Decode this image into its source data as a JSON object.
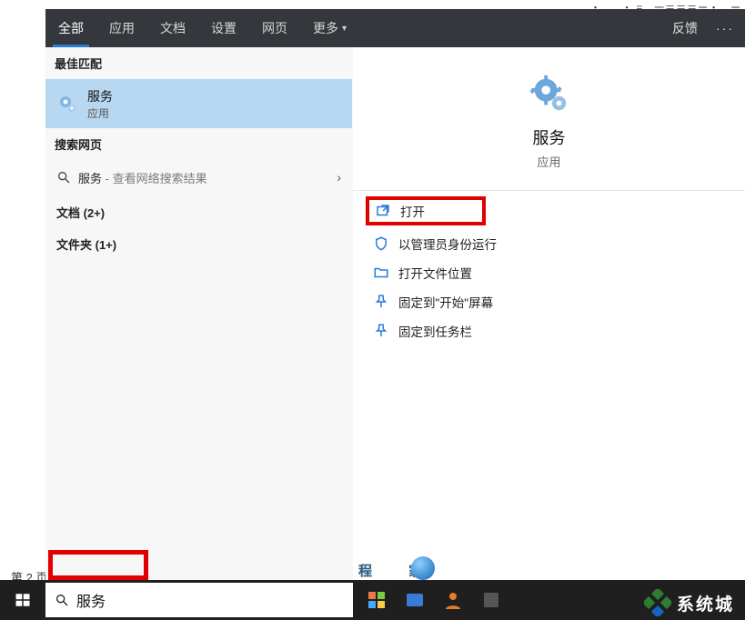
{
  "top_fragment": "．、 ．・． ．・ =…一＝＝＝ー・．ー・．・… 一气・・=・・",
  "page_label": "第 2 页",
  "tabs": {
    "items": [
      {
        "label": "全部",
        "active": true
      },
      {
        "label": "应用",
        "active": false
      },
      {
        "label": "文档",
        "active": false
      },
      {
        "label": "设置",
        "active": false
      },
      {
        "label": "网页",
        "active": false
      },
      {
        "label": "更多",
        "active": false,
        "has_caret": true
      }
    ],
    "feedback": "反馈",
    "more_dots": "···"
  },
  "left": {
    "best_match": "最佳匹配",
    "result": {
      "title": "服务",
      "subtitle": "应用"
    },
    "search_web_heading": "搜索网页",
    "web_item_main": "服务",
    "web_item_dim": " - 查看网络搜索结果",
    "docs_heading": "文档 (2+)",
    "folders_heading": "文件夹 (1+)"
  },
  "detail": {
    "title": "服务",
    "subtitle": "应用",
    "actions": [
      {
        "key": "open",
        "label": "打开",
        "icon": "open"
      },
      {
        "key": "run-admin",
        "label": "以管理员身份运行",
        "icon": "shield"
      },
      {
        "key": "open-loc",
        "label": "打开文件位置",
        "icon": "folder"
      },
      {
        "key": "pin-start",
        "label": "固定到\"开始\"屏幕",
        "icon": "pin"
      },
      {
        "key": "pin-taskbar",
        "label": "固定到任务栏",
        "icon": "pin"
      }
    ]
  },
  "search": {
    "value": "服务",
    "placeholder": ""
  },
  "ghost_text": "程 ㅤ 家",
  "brand": "系统城"
}
